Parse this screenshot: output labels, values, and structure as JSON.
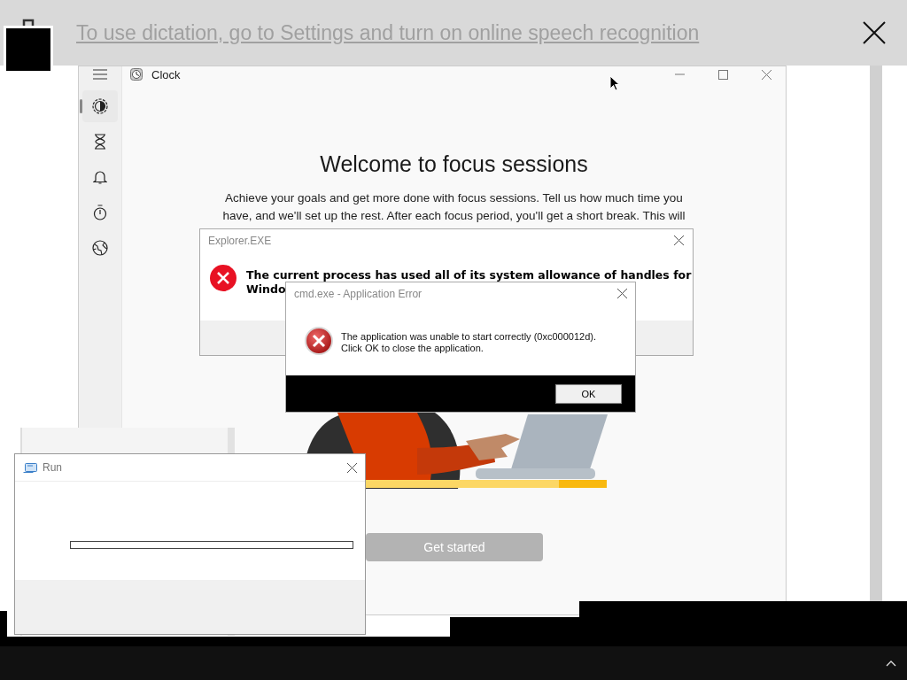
{
  "dictation_banner": {
    "text": "To use dictation, go to Settings and turn on online speech recognition"
  },
  "clock_window": {
    "title": "Clock",
    "nav_items": [
      {
        "kind": "focus",
        "selected": true
      },
      {
        "kind": "timer",
        "selected": false
      },
      {
        "kind": "alarm",
        "selected": false
      },
      {
        "kind": "stopwatch",
        "selected": false
      },
      {
        "kind": "world",
        "selected": false
      }
    ],
    "heading": "Welcome to focus sessions",
    "description_lines": [
      "Achieve your goals and get more done with focus sessions. Tell us how much time you",
      "have, and we'll set up the rest. After each focus period, you'll get a short break. This will"
    ],
    "button": "Get started"
  },
  "explorer_dialog": {
    "title": "Explorer.EXE",
    "message_lines": [
      "The current process has used all of its system allowance of handles for",
      "Windo"
    ]
  },
  "cmd_dialog": {
    "title": "cmd.exe - Application Error",
    "message_lines": [
      "The application was unable to start correctly (0xc000012d).",
      "Click OK to close the application."
    ],
    "button": "OK"
  },
  "run_dialog": {
    "title": "Run"
  }
}
